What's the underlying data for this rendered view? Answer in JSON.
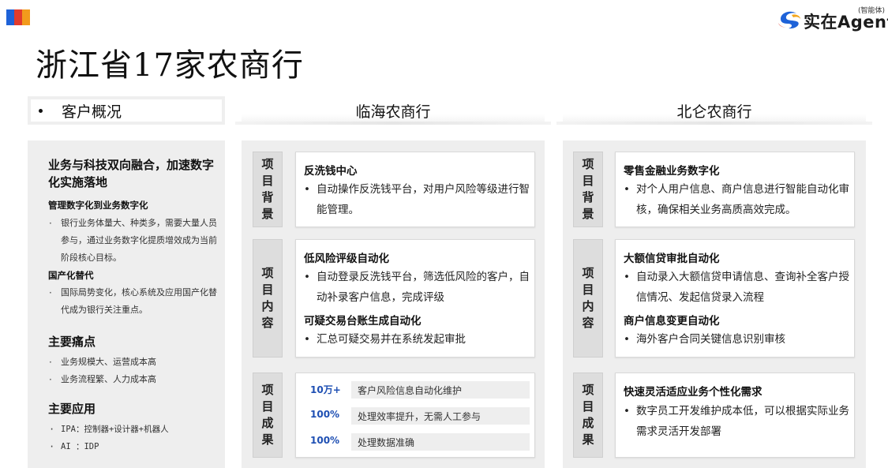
{
  "page": {
    "title": "浙江省17家农商行"
  },
  "logo": {
    "text": "实在Agent",
    "tag": "(智能体)"
  },
  "overview": {
    "header": "客户概况",
    "headline": "业务与科技双向融合，加速数字化实施落地",
    "sub1": "管理数字化到业务数字化",
    "sub1_items": [
      "银行业务体量大、种类多，需要大量人员参与，通过业务数字化提质增效成为当前阶段核心目标。"
    ],
    "sub2": "国产化替代",
    "sub2_items": [
      "国际局势变化，核心系统及应用国产化替代成为银行关注重点。"
    ],
    "pain_title": "主要痛点",
    "pain_items": [
      "业务规模大、运营成本高",
      "业务流程繁、人力成本高"
    ],
    "app_title": "主要应用",
    "app_items": [
      "IPA：控制器+设计器+机器人",
      " AI ：IDP"
    ]
  },
  "linhai": {
    "header": "临海农商行",
    "background": {
      "label": "项目背景",
      "title": "反洗钱中心",
      "text": "自动操作反洗钱平台，对用户风险等级进行智能管理。"
    },
    "content": {
      "label": "项目内容",
      "title1": "低风险评级自动化",
      "text1": "自动登录反洗钱平台，筛选低风险的客户，自动补录客户信息，完成评级",
      "title2": "可疑交易台账生成自动化",
      "text2": "汇总可疑交易并在系统发起审批"
    },
    "results": {
      "label": "项目成果",
      "rows": [
        {
          "num": "10万+",
          "desc": "客户风险信息自动化维护"
        },
        {
          "num": "100%",
          "desc": "处理效率提升，无需人工参与"
        },
        {
          "num": "100%",
          "desc": "处理数据准确"
        }
      ]
    }
  },
  "beilun": {
    "header": "北仑农商行",
    "background": {
      "label": "项目背景",
      "title": "零售金融业务数字化",
      "text": "对个人用户信息、商户信息进行智能自动化审核，确保相关业务高质高效完成。"
    },
    "content": {
      "label": "项目内容",
      "title1": "大额信贷审批自动化",
      "text1": "自动录入大额信贷申请信息、查询补全客户授信情况、发起信贷录入流程",
      "title2": "商户信息变更自动化",
      "text2": "海外客户合同关键信息识别审核"
    },
    "results": {
      "label": "项目成果",
      "title": "快速灵活适应业务个性化需求",
      "text": "数字员工开发维护成本低，可以根据实际业务需求灵活开发部署"
    }
  },
  "colors": {
    "accent_blue": "#1e4fb3",
    "panel_gray": "#eeeeee",
    "label_gray": "#dddddd"
  },
  "icons": [
    "corner-mark-icon",
    "logo-swirl-icon"
  ]
}
